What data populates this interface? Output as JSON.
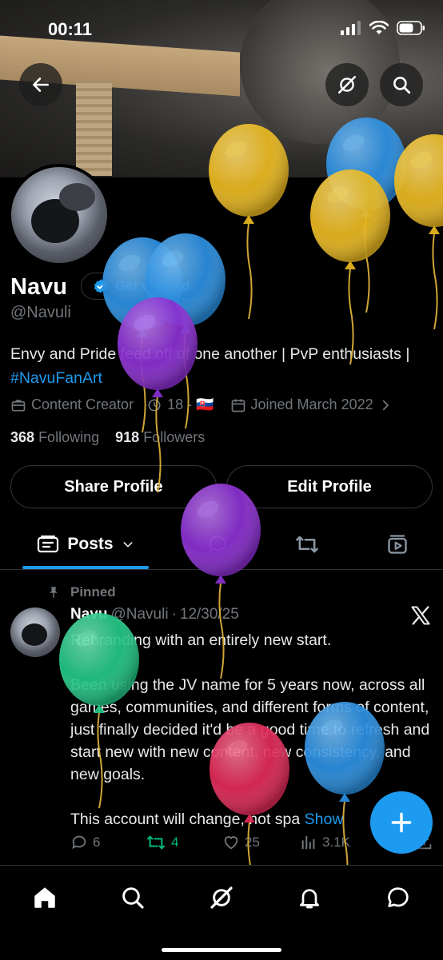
{
  "status_bar": {
    "time": "00:11"
  },
  "profile": {
    "name": "Navu",
    "verify_label": "Get verified",
    "handle": "@Navuli",
    "bio_text": "Envy and Pride feed off of one another | PvP enthusiasts | ",
    "bio_hashtag": "#NavuFanArt",
    "category": "Content Creator",
    "age_flag": "18 - 🇸🇰",
    "joined": "Joined March 2022",
    "following_count": "368",
    "following_label": "Following",
    "followers_count": "918",
    "followers_label": "Followers"
  },
  "actions": {
    "share_label": "Share Profile",
    "edit_label": "Edit Profile"
  },
  "tabs": {
    "posts_label": "Posts"
  },
  "pinned_post": {
    "pinned_label": "Pinned",
    "author": "Navu",
    "handle": "@Navuli",
    "separator": "·",
    "date": "12/30/25",
    "paragraphs": [
      "Rebranding with an entirely new start.",
      "Been using the JV name for 5 years now, across all games, communities, and different forms of content, just finally decided it'd be a good time to refresh and start new with new content, new consistency, and new goals.",
      "This account will change, not spa"
    ],
    "show_more": "Show",
    "stats": {
      "replies": "6",
      "reposts": "4",
      "likes": "25",
      "views": "3.1K"
    }
  },
  "colors": {
    "accent": "#1d9bf0",
    "repost_green": "#00ba7c",
    "muted": "#71767b",
    "background": "#000000"
  },
  "balloons": [
    {
      "color": "#e9b820",
      "highlight": "#f6d45a"
    },
    {
      "color": "#2b8fe0",
      "highlight": "#6fbcf5"
    },
    {
      "color": "#e9b820",
      "highlight": "#f6d45a"
    },
    {
      "color": "#e9b820",
      "highlight": "#f6d45a"
    },
    {
      "color": "#2b8fe0",
      "highlight": "#6fbcf5"
    },
    {
      "color": "#2b8fe0",
      "highlight": "#6fbcf5"
    },
    {
      "color": "#8a2fd0",
      "highlight": "#b777ef"
    },
    {
      "color": "#8a2fd0",
      "highlight": "#b777ef"
    },
    {
      "color": "#22c585",
      "highlight": "#6fe2b3"
    },
    {
      "color": "#e02a58",
      "highlight": "#f27695"
    },
    {
      "color": "#2b8fe0",
      "highlight": "#6fbcf5"
    }
  ]
}
